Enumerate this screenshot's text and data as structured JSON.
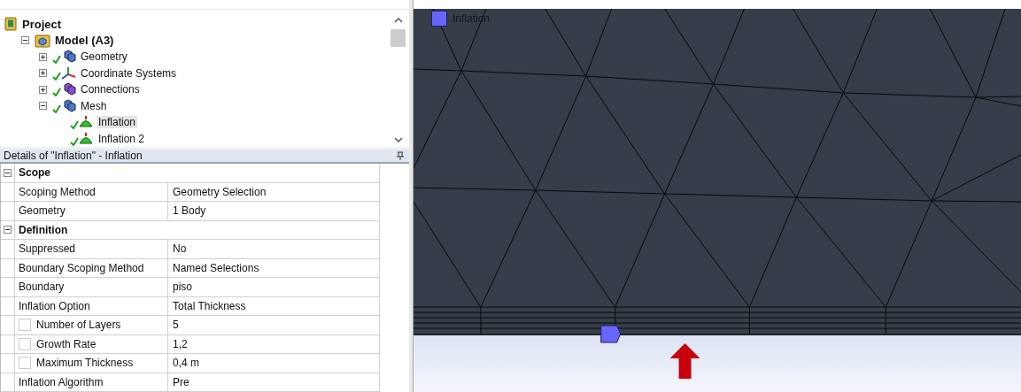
{
  "tree": {
    "label": "Project",
    "kind": "project",
    "children": [
      {
        "label": "Model (A3)",
        "kind": "model",
        "expanded": true,
        "children": [
          {
            "label": "Geometry",
            "kind": "geometry",
            "checked": true,
            "expanded": false
          },
          {
            "label": "Coordinate Systems",
            "kind": "axes",
            "checked": true,
            "expanded": false
          },
          {
            "label": "Connections",
            "kind": "connections",
            "checked": true,
            "expanded": false
          },
          {
            "label": "Mesh",
            "kind": "mesh",
            "checked": true,
            "expanded": true,
            "children": [
              {
                "label": "Inflation",
                "kind": "inflation",
                "checked": true,
                "selected": true
              },
              {
                "label": "Inflation 2",
                "kind": "inflation",
                "checked": true,
                "selected": false
              }
            ]
          }
        ]
      }
    ]
  },
  "details": {
    "title": "Details of \"Inflation\" - Inflation",
    "sections": [
      {
        "label": "Scope",
        "expanded": true,
        "rows": [
          {
            "kind": "plain",
            "label": "Scoping Method",
            "value": "Geometry Selection"
          },
          {
            "kind": "plain",
            "label": "Geometry",
            "value": "1 Body"
          }
        ]
      },
      {
        "label": "Definition",
        "expanded": true,
        "rows": [
          {
            "kind": "plain",
            "label": "Suppressed",
            "value": "No"
          },
          {
            "kind": "plain",
            "label": "Boundary Scoping Method",
            "value": "Named Selections"
          },
          {
            "kind": "plain",
            "label": "Boundary",
            "value": "piso"
          },
          {
            "kind": "plain",
            "label": "Inflation Option",
            "value": "Total Thickness"
          },
          {
            "kind": "checkbox",
            "checked": false,
            "label": "Number of Layers",
            "value": "5"
          },
          {
            "kind": "checkbox",
            "checked": false,
            "label": "Growth Rate",
            "value": "1,2"
          },
          {
            "kind": "checkbox",
            "checked": false,
            "label": "Maximum Thickness",
            "value": "0,4 m"
          },
          {
            "kind": "plain",
            "label": "Inflation Algorithm",
            "value": "Pre"
          }
        ]
      }
    ]
  },
  "viewport": {
    "legend": {
      "label": "Inflation",
      "color": "#6666ff"
    }
  }
}
